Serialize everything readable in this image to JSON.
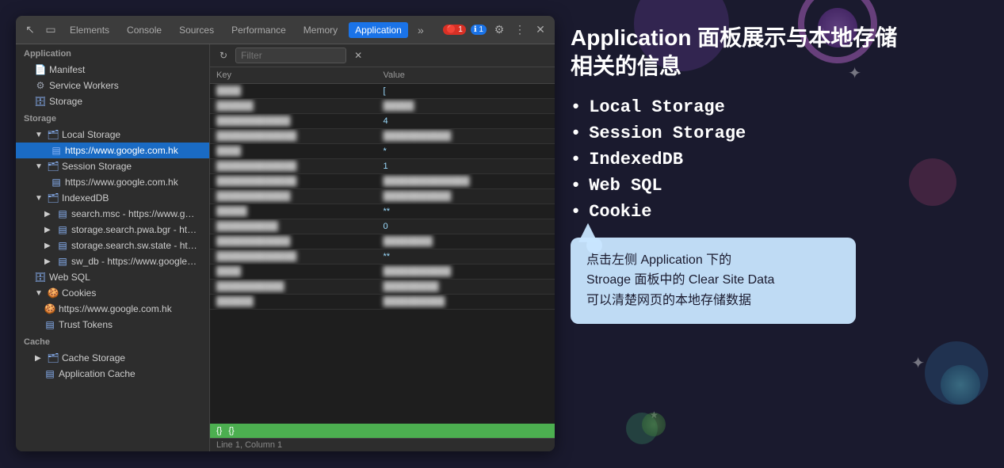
{
  "background": {
    "color": "#1a1a2e"
  },
  "devtools": {
    "tabs": [
      {
        "label": "Elements",
        "active": false
      },
      {
        "label": "Console",
        "active": false
      },
      {
        "label": "Sources",
        "active": false
      },
      {
        "label": "Performance",
        "active": false
      },
      {
        "label": "Memory",
        "active": false
      },
      {
        "label": "Application",
        "active": true
      }
    ],
    "filter_placeholder": "Filter",
    "table": {
      "headers": [
        "Key",
        "Value"
      ],
      "rows": [
        {
          "key": "blurred1",
          "value": "["
        },
        {
          "key": "blurred2",
          "value": "1_____________6"
        },
        {
          "key": "blurred3",
          "value": "4"
        },
        {
          "key": "blurred4",
          "value": "___________"
        },
        {
          "key": "blurred5",
          "value": "*"
        },
        {
          "key": "blurred6",
          "value": "1"
        },
        {
          "key": "blurred7",
          "value": "___  _cal"
        },
        {
          "key": "blurred8",
          "value": "p_______________"
        },
        {
          "key": "blurred9",
          "value": "**"
        },
        {
          "key": "blurred10",
          "value": "0"
        },
        {
          "key": "blurred11",
          "value": "_______________"
        },
        {
          "key": "blurred12",
          "value": "**"
        },
        {
          "key": "blurred13",
          "value": "_______________"
        },
        {
          "key": "blurred14",
          "value": "w_____as"
        },
        {
          "key": "blurred15",
          "value": "[{_______8___"
        }
      ]
    },
    "code_row": {
      "icon1": "{}",
      "icon2": "{}"
    },
    "status_bar": "Line 1, Column 1"
  },
  "sidebar": {
    "top_section": "Application",
    "top_items": [
      {
        "label": "Manifest",
        "icon": "doc",
        "indent": 1
      },
      {
        "label": "Service Workers",
        "icon": "gear",
        "indent": 1
      },
      {
        "label": "Storage",
        "icon": "db",
        "indent": 1
      }
    ],
    "storage_section": "Storage",
    "storage_items": [
      {
        "label": "Local Storage",
        "icon": "folder",
        "indent": 1,
        "expanded": true
      },
      {
        "label": "https://www.google.com.hk",
        "icon": "db",
        "indent": 3,
        "active": true
      },
      {
        "label": "Session Storage",
        "icon": "folder",
        "indent": 1,
        "expanded": true
      },
      {
        "label": "https://www.google.com.hk",
        "icon": "db",
        "indent": 3
      },
      {
        "label": "IndexedDB",
        "icon": "folder",
        "indent": 1,
        "expanded": true
      },
      {
        "label": "search.msc - https://www.google.c...",
        "icon": "db",
        "indent": 2
      },
      {
        "label": "storage.search.pwa.bgr - https://w...",
        "icon": "db",
        "indent": 2
      },
      {
        "label": "storage.search.sw.state - https://w...",
        "icon": "db",
        "indent": 2
      },
      {
        "label": "sw_db - https://www.google.com.hk",
        "icon": "db",
        "indent": 2
      },
      {
        "label": "Web SQL",
        "icon": "db",
        "indent": 1
      },
      {
        "label": "Cookies",
        "icon": "folder",
        "indent": 1,
        "expanded": true
      },
      {
        "label": "https://www.google.com.hk",
        "icon": "cookie",
        "indent": 2
      },
      {
        "label": "Trust Tokens",
        "icon": "db",
        "indent": 2
      }
    ],
    "cache_section": "Cache",
    "cache_items": [
      {
        "label": "Cache Storage",
        "icon": "folder",
        "indent": 1
      },
      {
        "label": "Application Cache",
        "icon": "db",
        "indent": 2
      }
    ]
  },
  "right_panel": {
    "title": "Application 面板展示与本地存储\n相关的信息",
    "list_items": [
      "Local Storage",
      "Session Storage",
      "IndexedDB",
      "Web SQL",
      "Cookie"
    ],
    "tooltip": "点击左侧 Application 下的\nStroage 面板中的 Clear Site Data\n可以清楚网页的本地存储数据"
  }
}
